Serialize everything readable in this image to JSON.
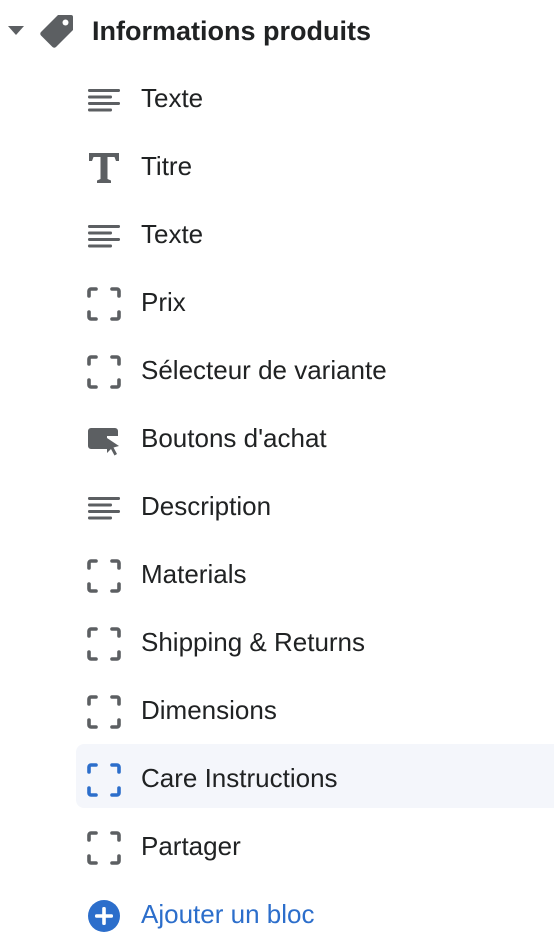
{
  "section": {
    "title": "Informations produits",
    "icon": "tag-icon",
    "expanded": true
  },
  "blocks": [
    {
      "label": "Texte",
      "icon": "text-lines-icon"
    },
    {
      "label": "Titre",
      "icon": "title-t-icon"
    },
    {
      "label": "Texte",
      "icon": "text-lines-icon"
    },
    {
      "label": "Prix",
      "icon": "dashed-frame-icon"
    },
    {
      "label": "Sélecteur de variante",
      "icon": "dashed-frame-icon"
    },
    {
      "label": "Boutons d'achat",
      "icon": "buy-button-cursor-icon"
    },
    {
      "label": "Description",
      "icon": "text-lines-icon"
    },
    {
      "label": "Materials",
      "icon": "dashed-frame-icon"
    },
    {
      "label": "Shipping & Returns",
      "icon": "dashed-frame-icon"
    },
    {
      "label": "Dimensions",
      "icon": "dashed-frame-icon"
    },
    {
      "label": "Care Instructions",
      "icon": "dashed-frame-icon",
      "selected": true
    },
    {
      "label": "Partager",
      "icon": "dashed-frame-icon"
    }
  ],
  "add_block": {
    "label": "Ajouter un bloc",
    "icon": "plus-circle-icon"
  },
  "colors": {
    "text": "#202223",
    "icon": "#5c5f62",
    "accent": "#2c6ecb",
    "selected_bg": "#f4f6fb"
  }
}
